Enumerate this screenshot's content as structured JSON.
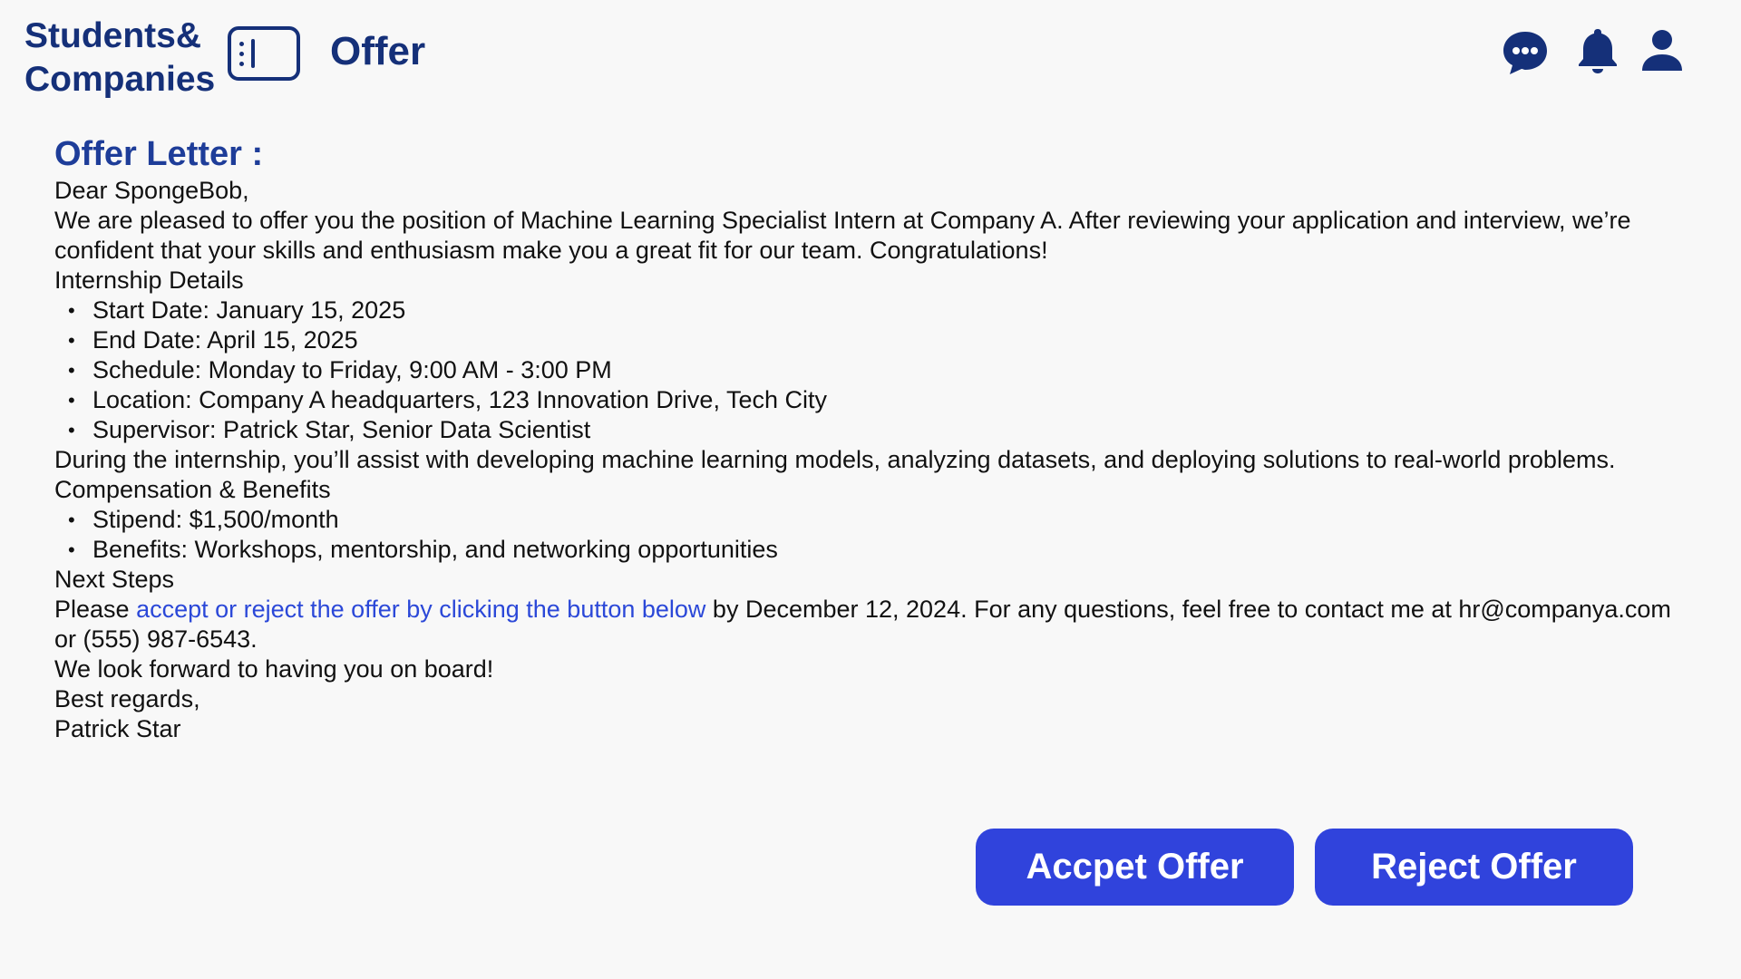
{
  "header": {
    "brand_line1": "Students&",
    "brand_line2": "Companies",
    "page_title": "Offer",
    "icons": [
      "sidebar-toggle-icon",
      "chat-icon",
      "bell-icon",
      "user-icon"
    ]
  },
  "letter": {
    "title": "Offer Letter :",
    "greeting": "Dear SpongeBob,",
    "intro": "We are pleased to offer you the position of Machine Learning Specialist Intern at Company A. After reviewing your application and interview, we’re confident that your skills and enthusiasm make you a great fit for our team. Congratulations!",
    "details_heading": "Internship Details",
    "details": [
      "Start Date: January 15, 2025",
      "End Date: April 15, 2025",
      "Schedule: Monday to Friday, 9:00 AM - 3:00 PM",
      "Location: Company A headquarters, 123 Innovation Drive, Tech City",
      "Supervisor: Patrick Star, Senior Data Scientist"
    ],
    "duties": "During the internship, you’ll assist with developing machine learning models, analyzing datasets, and deploying solutions to real-world problems.",
    "comp_heading": "Compensation & Benefits",
    "comp": [
      "Stipend: $1,500/month",
      "Benefits: Workshops, mentorship, and networking opportunities"
    ],
    "next_heading": "Next Steps",
    "next_prefix": "Please ",
    "next_link": "accept or reject the offer by clicking the button below",
    "next_suffix": " by December 12, 2024. For any questions, feel free to contact me at hr@companya.com or (555) 987-6543.",
    "closing": "We look forward to having you on board!",
    "regards": "Best regards,",
    "signature": "Patrick Star"
  },
  "actions": {
    "accept_label": "Accpet Offer",
    "reject_label": "Reject Offer"
  },
  "colors": {
    "brand": "#153079",
    "title": "#1e3d99",
    "link": "#2b48d8",
    "button": "#3043dc",
    "background": "#f8f8f8"
  }
}
